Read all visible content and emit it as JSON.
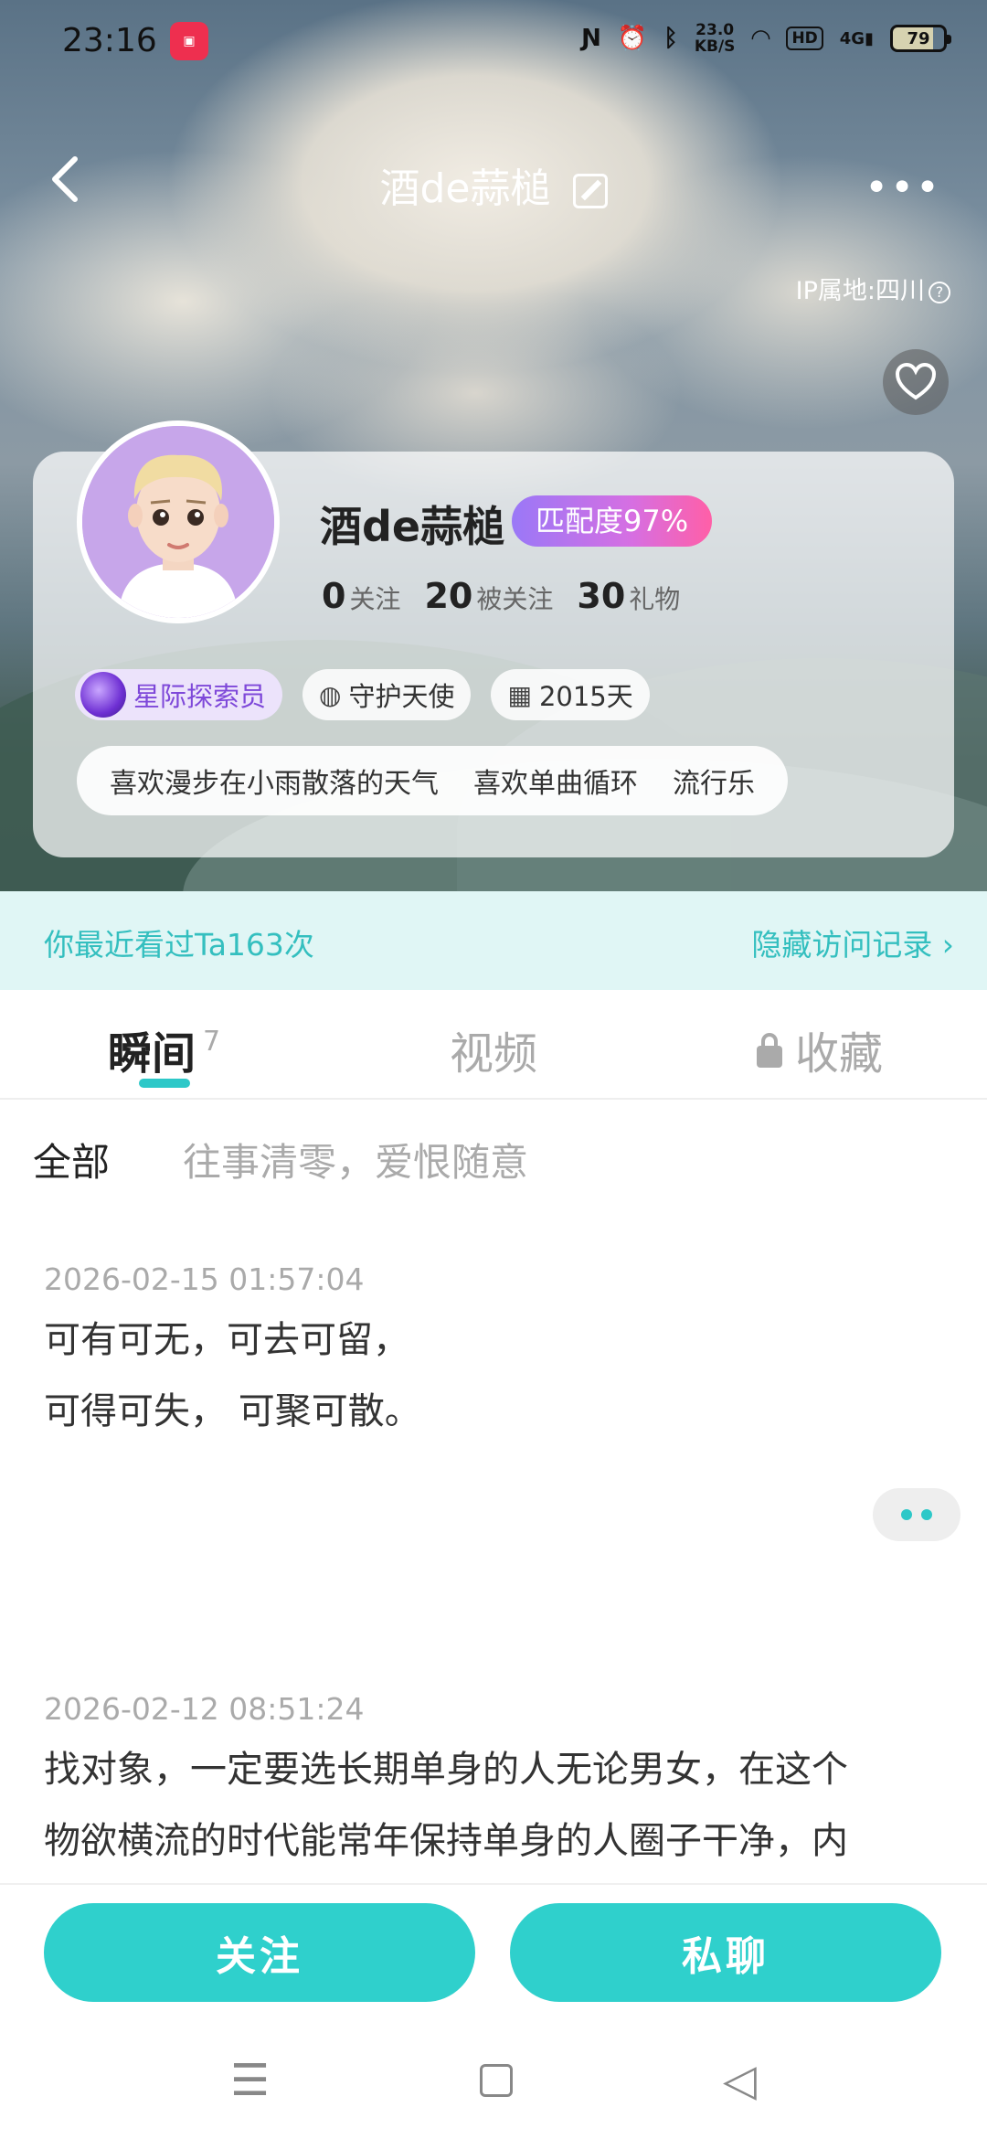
{
  "status_bar": {
    "time": "23:16",
    "network_speed": "23.0\nKB/S",
    "signal": "4G",
    "hd": "HD",
    "battery": "79"
  },
  "nav": {
    "title": "酒de蒜槌",
    "more": "•••"
  },
  "ip_location": "IP属地:四川",
  "profile": {
    "name": "酒de蒜槌",
    "match": "匹配度97%",
    "stats": [
      {
        "value": "0",
        "label": "关注"
      },
      {
        "value": "20",
        "label": "被关注"
      },
      {
        "value": "30",
        "label": "礼物"
      }
    ],
    "badges": {
      "explorer": "星际探索员",
      "guardian": "守护天使",
      "days": "2015天"
    },
    "tags": [
      "喜欢漫步在小雨散落的天气",
      "喜欢单曲循环",
      "流行乐"
    ]
  },
  "visit": {
    "left": "你最近看过Ta163次",
    "right": "隐藏访问记录 ›"
  },
  "tabs": [
    {
      "label": "瞬间",
      "count": "7"
    },
    {
      "label": "视频"
    },
    {
      "label": "收藏"
    }
  ],
  "filter": {
    "label": "全部",
    "signature": "往事清零，爱恨随意"
  },
  "posts": [
    {
      "date": "2026-02-15 01:57:04",
      "lines": [
        "可有可无，可去可留，",
        "可得可失， 可聚可散。"
      ]
    },
    {
      "date": "2026-02-12 08:51:24",
      "lines": [
        "找对象，一定要选长期单身的人无论男女，在这个",
        "物欲横流的时代能常年保持单身的人圈子干净，内"
      ]
    }
  ],
  "actions": {
    "follow": "关注",
    "chat": "私聊"
  },
  "colors": {
    "accent": "#2fd0cc",
    "accent_text": "#34bfbf",
    "match_gradient_start": "#9a78f7",
    "match_gradient_end": "#ff5fa7"
  }
}
